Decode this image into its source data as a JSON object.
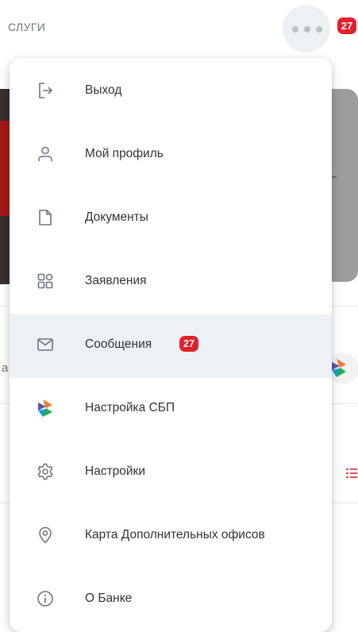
{
  "header": {
    "title_fragment": "СЛУГИ",
    "notifications_badge": "27"
  },
  "background": {
    "left_text_fragment": "а"
  },
  "menu": {
    "items": [
      {
        "label": "Выход",
        "icon": "logout-icon"
      },
      {
        "label": "Мой профиль",
        "icon": "user-icon"
      },
      {
        "label": "Документы",
        "icon": "document-icon"
      },
      {
        "label": "Заявления",
        "icon": "grid-icon"
      },
      {
        "label": "Сообщения",
        "icon": "envelope-icon",
        "badge": "27",
        "active": true
      },
      {
        "label": "Настройка СБП",
        "icon": "sbp-logo-icon"
      },
      {
        "label": "Настройки",
        "icon": "gear-icon"
      },
      {
        "label": "Карта Дополнительных офисов",
        "icon": "map-pin-icon"
      },
      {
        "label": "О Банке",
        "icon": "info-icon"
      }
    ]
  },
  "colors": {
    "accent_red": "#e3202c",
    "text": "#333333",
    "icon_gray": "#6b7480",
    "active_row": "#eef1f4"
  }
}
